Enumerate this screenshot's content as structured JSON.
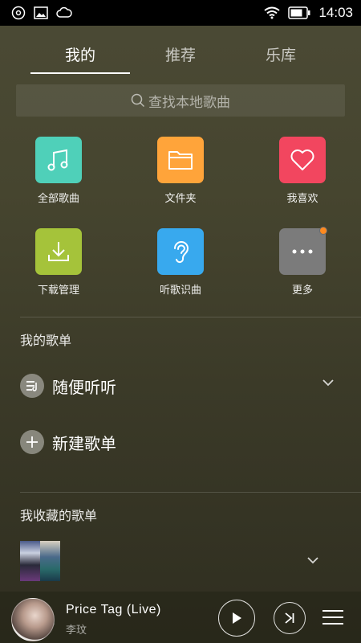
{
  "status_bar": {
    "time": "14:03"
  },
  "tabs": [
    {
      "label": "我的",
      "active": true
    },
    {
      "label": "推荐",
      "active": false
    },
    {
      "label": "乐库",
      "active": false
    }
  ],
  "search": {
    "placeholder": "查找本地歌曲"
  },
  "grid": [
    {
      "label": "全部歌曲",
      "icon": "music-note-icon",
      "color": "#4fd0b9"
    },
    {
      "label": "文件夹",
      "icon": "folder-icon",
      "color": "#ffa43a"
    },
    {
      "label": "我喜欢",
      "icon": "heart-icon",
      "color": "#f2465f"
    },
    {
      "label": "下载管理",
      "icon": "download-icon",
      "color": "#a5c33a"
    },
    {
      "label": "听歌识曲",
      "icon": "ear-icon",
      "color": "#38a9ee"
    },
    {
      "label": "更多",
      "icon": "more-icon",
      "color": "#7b7b7b"
    }
  ],
  "my_playlists": {
    "title": "我的歌单",
    "items": [
      {
        "label": "随便听听",
        "icon": "playlist-icon"
      },
      {
        "label": "新建歌单",
        "icon": "plus-icon"
      }
    ]
  },
  "favorite_playlists": {
    "title": "我收藏的歌单"
  },
  "player": {
    "title": "Price Tag  (Live)",
    "artist": "李玟"
  }
}
